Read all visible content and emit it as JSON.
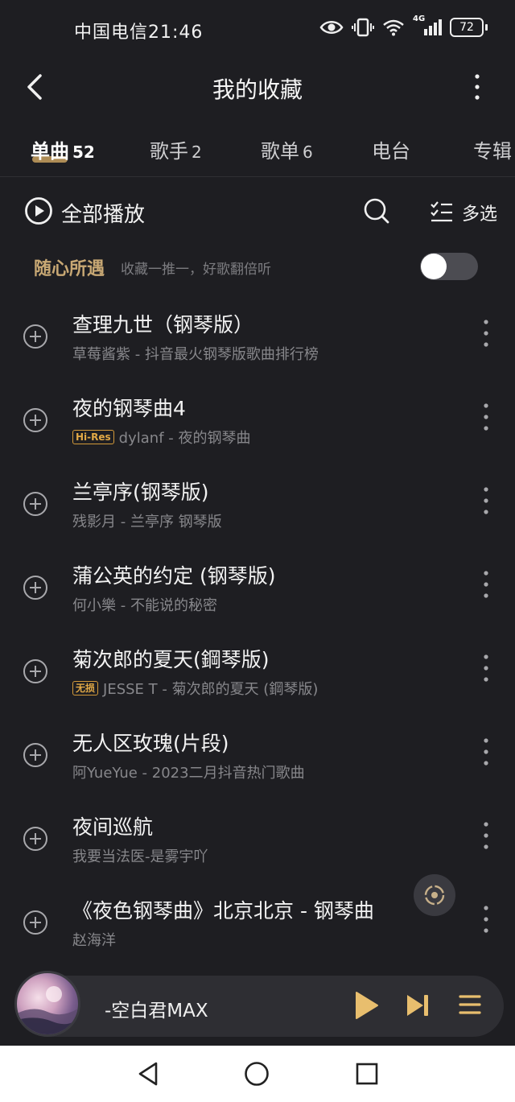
{
  "status_bar": {
    "carrier_time": "中国电信21:46",
    "network": "4G",
    "battery": "72"
  },
  "header": {
    "title": "我的收藏"
  },
  "tabs": [
    {
      "label": "单曲",
      "count": "52"
    },
    {
      "label": "歌手",
      "count": "2"
    },
    {
      "label": "歌单",
      "count": "6"
    },
    {
      "label": "电台",
      "count": ""
    },
    {
      "label": "专辑",
      "count": ""
    }
  ],
  "actions": {
    "play_all": "全部播放",
    "multi_select": "多选"
  },
  "random": {
    "title": "随心所遇",
    "desc": "收藏一推一，好歌翻倍听",
    "enabled": false
  },
  "songs": [
    {
      "title": "查理九世（钢琴版）",
      "badge": "",
      "subtitle": "草莓酱紫 - 抖音最火钢琴版歌曲排行榜"
    },
    {
      "title": "夜的钢琴曲4",
      "badge": "Hi-Res",
      "subtitle": "dylanf - 夜的钢琴曲"
    },
    {
      "title": "兰亭序(钢琴版)",
      "badge": "",
      "subtitle": "残影月 - 兰亭序 钢琴版"
    },
    {
      "title": "蒲公英的约定 (钢琴版)",
      "badge": "",
      "subtitle": "何小樂 - 不能说的秘密"
    },
    {
      "title": "菊次郎的夏天(鋼琴版)",
      "badge": "无损",
      "subtitle": "JESSE T - 菊次郎的夏天 (鋼琴版)"
    },
    {
      "title": "无人区玫瑰(片段)",
      "badge": "",
      "subtitle": "阿YueYue - 2023二月抖音热门歌曲"
    },
    {
      "title": "夜间巡航",
      "badge": "",
      "subtitle": "我要当法医-是雾宇吖"
    },
    {
      "title": "《夜色钢琴曲》北京北京 - 钢琴曲",
      "badge": "",
      "subtitle": "赵海洋"
    }
  ],
  "player": {
    "now_playing": "-空白君MAX"
  },
  "colors": {
    "background": "#1e1e22",
    "accent_gold": "#c8a05e",
    "badge_orange": "#d39a3a"
  }
}
